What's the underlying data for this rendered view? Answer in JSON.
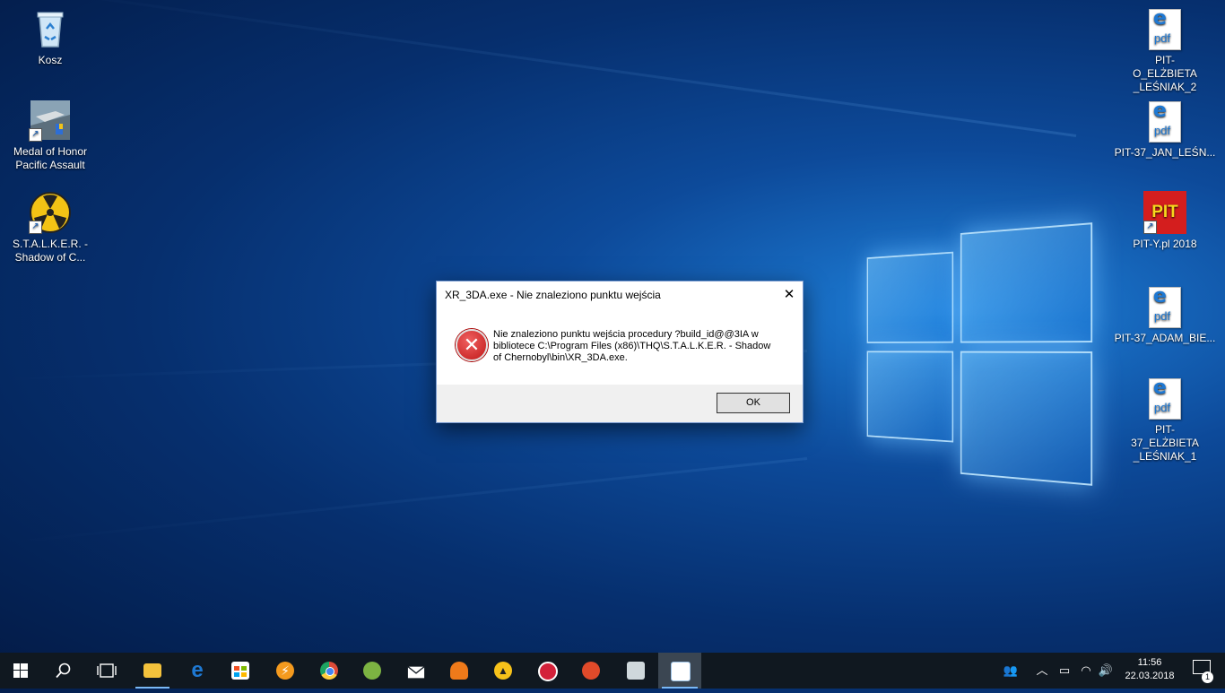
{
  "desktop_left": [
    {
      "label": "Kosz",
      "icon": "recycle-bin-icon"
    },
    {
      "label": "Medal of Honor\nPacific Assault",
      "icon": "medal-of-honor-icon"
    },
    {
      "label": "S.T.A.L.K.E.R. -\nShadow of C...",
      "icon": "stalker-icon"
    }
  ],
  "desktop_right": [
    {
      "label": "PIT-O_ELŻBIETA\n_LEŚNIAK_2",
      "icon": "edge-pdf-icon"
    },
    {
      "label": "PIT-37_JAN_LEŚN...",
      "icon": "edge-pdf-icon"
    },
    {
      "label": "PIT-Y.pl 2018",
      "icon": "pit-app-icon",
      "badge": "PIT"
    },
    {
      "label": "PIT-37_ADAM_BIE...",
      "icon": "edge-pdf-icon"
    },
    {
      "label": "PIT-37_ELŻBIETA\n_LEŚNIAK_1",
      "icon": "edge-pdf-icon"
    }
  ],
  "pdf_glyph": {
    "e": "e",
    "p": "pdf"
  },
  "dialog": {
    "title": "XR_3DA.exe - Nie znaleziono punktu wejścia",
    "close_glyph": "✕",
    "message": "Nie znaleziono punktu wejścia procedury ?build_id@@3IA w\nbibliotece C:\\Program Files (x86)\\THQ\\S.T.A.L.K.E.R. - Shadow\nof Chernobyl\\bin\\XR_3DA.exe.",
    "error_glyph": "✕",
    "ok_label": "OK"
  },
  "taskbar": {
    "apps": [
      {
        "name": "file-explorer",
        "color": "#f4c23c"
      },
      {
        "name": "edge",
        "color": "#1e78d2"
      },
      {
        "name": "store",
        "color": "#ffffff"
      },
      {
        "name": "winamp",
        "color": "#f49a1e"
      },
      {
        "name": "chrome",
        "color": "#dd4b39"
      },
      {
        "name": "app-green",
        "color": "#7cb342"
      },
      {
        "name": "mail",
        "color": "#ffffff"
      },
      {
        "name": "app-orange",
        "color": "#ef7a1a"
      },
      {
        "name": "app-yellow",
        "color": "#f7c21a"
      },
      {
        "name": "app-red",
        "color": "#d3213a"
      },
      {
        "name": "ccleaner",
        "color": "#e04a2a"
      },
      {
        "name": "media-player",
        "color": "#cfd8dc"
      },
      {
        "name": "stalker-window",
        "color": "#9ec3e6"
      }
    ],
    "clock_time": "11:56",
    "clock_date": "22.03.2018",
    "notification_count": "1"
  }
}
